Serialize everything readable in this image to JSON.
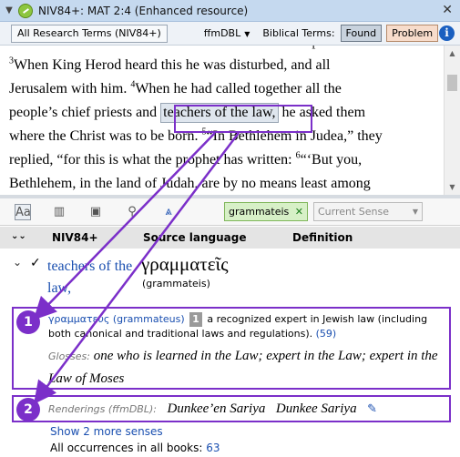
{
  "window": {
    "title": "NIV84+: MAT 2:4 (Enhanced resource)",
    "close_glyph": "✕",
    "collapse_glyph": "▼"
  },
  "toolbar": {
    "all_terms_label": "All Research Terms (NIV84+)",
    "dbl_label": "ffmDBL",
    "biblical_terms_label": "Biblical Terms:",
    "found_label": "Found",
    "problem_label": "Problem",
    "info_glyph": "i"
  },
  "text_pane": {
    "line0": "We saw his star in the east and have come to worship him.",
    "v3_num": "3",
    "line1": "When King Herod heard this he was disturbed, and all",
    "line2a": "Jerusalem with him. ",
    "v4_num": "4",
    "line2b": "When he had called together all the",
    "line3a": "people’s chief priests and ",
    "highlight": "teachers of the law,",
    "line3b": " he asked them",
    "line4a": "where the Christ was to be born. ",
    "v5_num": "5",
    "line4b": "“In Bethlehem in Judea,” they",
    "line5a": "replied, “for this is what the prophet has written: ",
    "v6_num": "6",
    "line5b": "“‘But you,",
    "line6": "Bethlehem, in the land of Judah, are by no means least among"
  },
  "tabs": {
    "search_value": "grammateis",
    "search_clear": "✕",
    "sense_select": "Current Sense"
  },
  "columns": {
    "col1": "NIV84+",
    "col2": "Source language",
    "col3": "Definition"
  },
  "entry": {
    "toggle": "⌄",
    "check": "✓",
    "term": "teachers of the law,",
    "greek": "γραμματεῖς",
    "translit": "(grammateis)"
  },
  "sense": {
    "badge": "1",
    "lemma": "γραμματεύς (grammateus)",
    "sense_number": "1",
    "definition": "a recognized expert in Jewish law (including both canonical and traditional laws and regulations).",
    "count": "(59)",
    "glosses_label": "Glosses:",
    "glosses": "one who is learned in the Law; expert in the Law; expert in the Law of Moses"
  },
  "renderings": {
    "badge": "2",
    "label": "Renderings (ffmDBL):",
    "r1": "Dunkee’en Sariya",
    "r2": "Dunkee Sariya",
    "edit_glyph": "✎"
  },
  "footer": {
    "more_senses": "Show 2 more senses",
    "all_occ_label": "All occurrences in all books: ",
    "all_occ_count": "63"
  },
  "colors": {
    "accent": "#7b2fc9",
    "link": "#1a4fb0",
    "found_bg": "#c8d2dd",
    "problem_bg": "#f7dccb",
    "search_bg": "#d7f0c7"
  }
}
